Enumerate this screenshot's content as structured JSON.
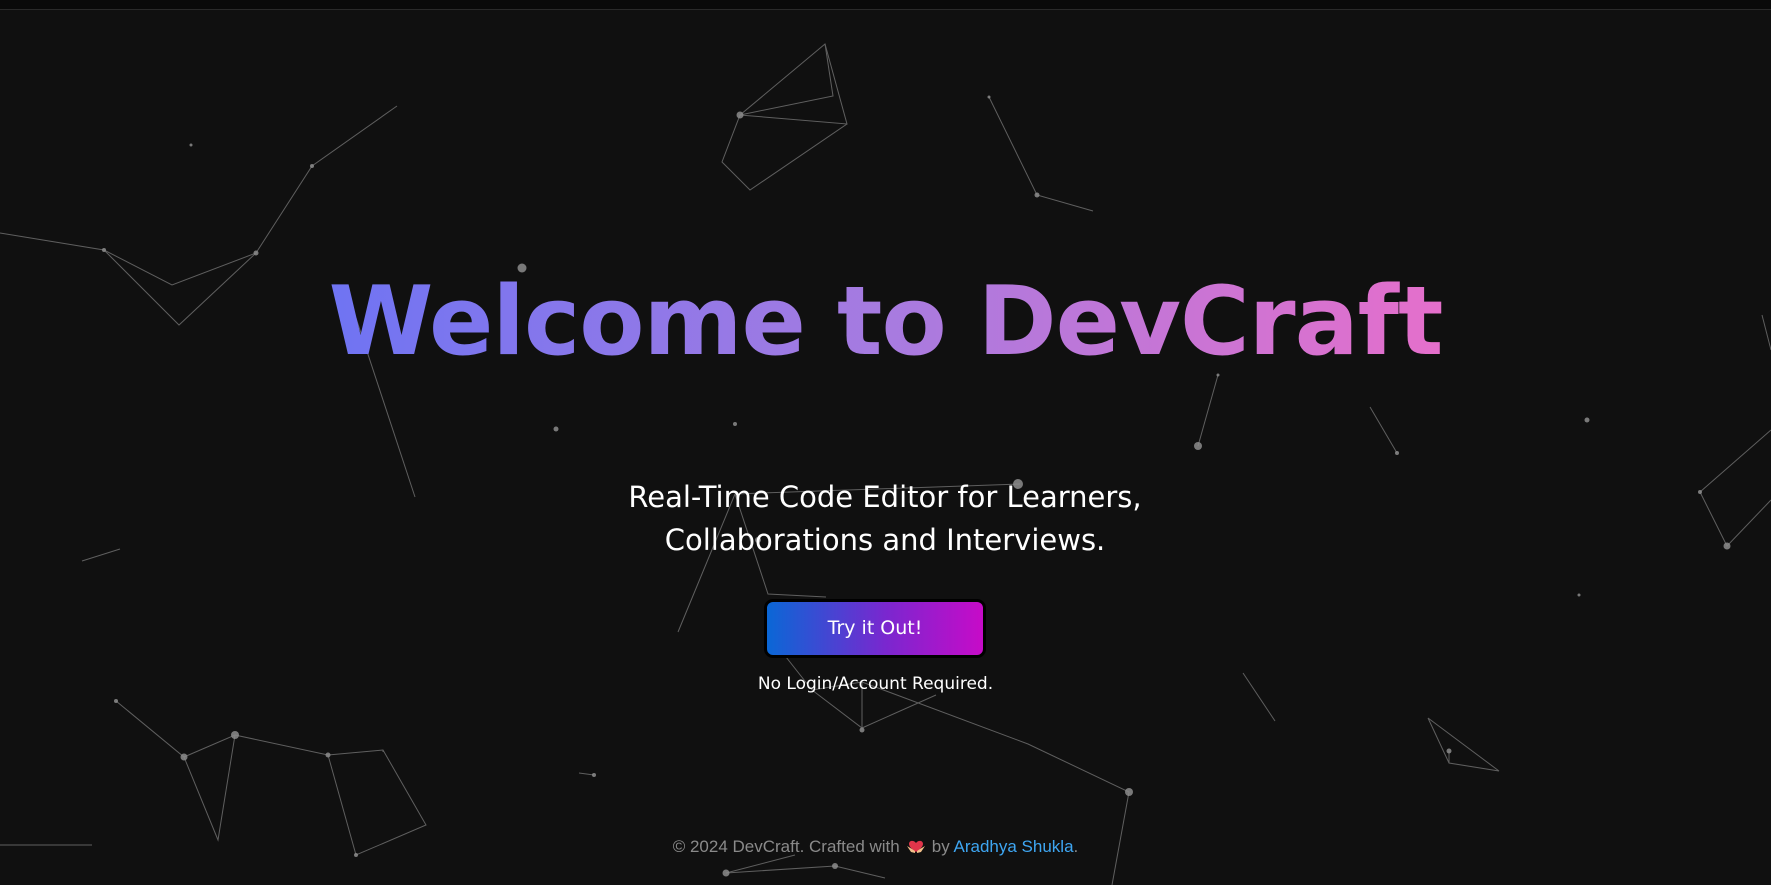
{
  "hero": {
    "title": "Welcome to DevCraft",
    "subtitle_line1": "Real-Time Code Editor for Learners,",
    "subtitle_line2": "Collaborations and Interviews.",
    "cta_label": "Try it Out!",
    "note": "No Login/Account Required."
  },
  "footer": {
    "prefix": "© 2024 DevCraft. Crafted with",
    "icon": "hands-heart-icon",
    "by": "by",
    "author": "Aradhya Shukla",
    "suffix": "."
  },
  "colors": {
    "background": "#101010",
    "title_gradient": [
      "#6f74f3",
      "#a77be0",
      "#e56fcb"
    ],
    "button_gradient": [
      "#0a67d6",
      "#7a27cf",
      "#c70bc8"
    ],
    "link": "#3ea6f2",
    "footer_text": "#8a8a8a",
    "particles": "#8c8c8c"
  }
}
